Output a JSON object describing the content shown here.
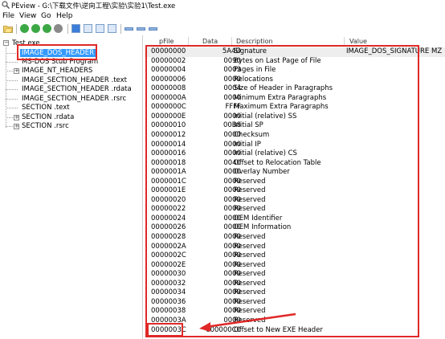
{
  "window": {
    "title": "PEview - G:\\下载文件\\逆向工程\\实验\\实验1\\Test.exe"
  },
  "menu": [
    "File",
    "View",
    "Go",
    "Help"
  ],
  "toolbar": {
    "icons": [
      "open-icon",
      "back-icon",
      "forward-icon",
      "previous-icon",
      "next-icon",
      "tree-view-icon",
      "hex-view-icon",
      "structure-up-icon",
      "structure-down-icon",
      "view-mode-1-icon",
      "view-mode-2-icon",
      "view-mode-3-icon"
    ]
  },
  "tree": {
    "root": "Test.exe",
    "items": [
      "IMAGE_DOS_HEADER",
      "MS-DOS Stub Program",
      "IMAGE_NT_HEADERS",
      "IMAGE_SECTION_HEADER .text",
      "IMAGE_SECTION_HEADER .rdata",
      "IMAGE_SECTION_HEADER .rsrc",
      "SECTION .text",
      "SECTION .rdata",
      "SECTION .rsrc"
    ]
  },
  "table": {
    "headers": {
      "offset": "pFile",
      "data": "Data",
      "description": "Description",
      "value": "Value"
    },
    "rows": [
      {
        "offset": "00000000",
        "data": "5A4D",
        "description": "Signature",
        "value": "IMAGE_DOS_SIGNATURE  MZ"
      },
      {
        "offset": "00000002",
        "data": "0090",
        "description": "Bytes on Last Page of File",
        "value": ""
      },
      {
        "offset": "00000004",
        "data": "0003",
        "description": "Pages in File",
        "value": ""
      },
      {
        "offset": "00000006",
        "data": "0000",
        "description": "Relocations",
        "value": ""
      },
      {
        "offset": "00000008",
        "data": "0004",
        "description": "Size of Header in Paragraphs",
        "value": ""
      },
      {
        "offset": "0000000A",
        "data": "0000",
        "description": "Minimum Extra Paragraphs",
        "value": ""
      },
      {
        "offset": "0000000C",
        "data": "FFFF",
        "description": "Maximum Extra Paragraphs",
        "value": ""
      },
      {
        "offset": "0000000E",
        "data": "0000",
        "description": "Initial (relative) SS",
        "value": ""
      },
      {
        "offset": "00000010",
        "data": "00B8",
        "description": "Initial SP",
        "value": ""
      },
      {
        "offset": "00000012",
        "data": "0000",
        "description": "Checksum",
        "value": ""
      },
      {
        "offset": "00000014",
        "data": "0000",
        "description": "Initial IP",
        "value": ""
      },
      {
        "offset": "00000016",
        "data": "0000",
        "description": "Initial (relative) CS",
        "value": ""
      },
      {
        "offset": "00000018",
        "data": "0040",
        "description": "Offset to Relocation Table",
        "value": ""
      },
      {
        "offset": "0000001A",
        "data": "0000",
        "description": "Overlay Number",
        "value": ""
      },
      {
        "offset": "0000001C",
        "data": "0000",
        "description": "Reserved",
        "value": ""
      },
      {
        "offset": "0000001E",
        "data": "0000",
        "description": "Reserved",
        "value": ""
      },
      {
        "offset": "00000020",
        "data": "0000",
        "description": "Reserved",
        "value": ""
      },
      {
        "offset": "00000022",
        "data": "0000",
        "description": "Reserved",
        "value": ""
      },
      {
        "offset": "00000024",
        "data": "0000",
        "description": "OEM Identifier",
        "value": ""
      },
      {
        "offset": "00000026",
        "data": "0000",
        "description": "OEM Information",
        "value": ""
      },
      {
        "offset": "00000028",
        "data": "0000",
        "description": "Reserved",
        "value": ""
      },
      {
        "offset": "0000002A",
        "data": "0000",
        "description": "Reserved",
        "value": ""
      },
      {
        "offset": "0000002C",
        "data": "0000",
        "description": "Reserved",
        "value": ""
      },
      {
        "offset": "0000002E",
        "data": "0000",
        "description": "Reserved",
        "value": ""
      },
      {
        "offset": "00000030",
        "data": "0000",
        "description": "Reserved",
        "value": ""
      },
      {
        "offset": "00000032",
        "data": "0000",
        "description": "Reserved",
        "value": ""
      },
      {
        "offset": "00000034",
        "data": "0000",
        "description": "Reserved",
        "value": ""
      },
      {
        "offset": "00000036",
        "data": "0000",
        "description": "Reserved",
        "value": ""
      },
      {
        "offset": "00000038",
        "data": "0000",
        "description": "Reserved",
        "value": ""
      },
      {
        "offset": "0000003A",
        "data": "0000",
        "description": "Reserved",
        "value": ""
      },
      {
        "offset": "0000003C",
        "data": "000000C0",
        "description": "Offset to New EXE Header",
        "value": ""
      }
    ]
  },
  "colors": {
    "selection": "#3399ff",
    "annotation": "#e02828",
    "row_highlight": "#eeeeee"
  }
}
